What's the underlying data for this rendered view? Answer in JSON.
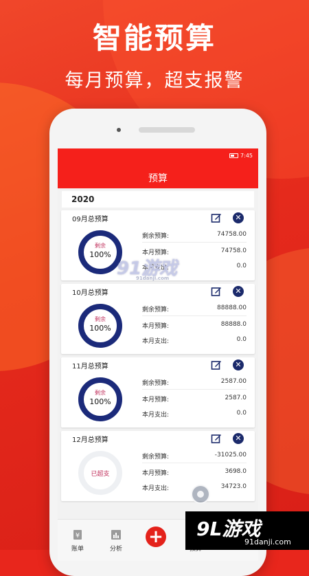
{
  "banner": {
    "title": "智能预算",
    "subtitle": "每月预算，超支报警"
  },
  "status_bar": {
    "time": "7:45"
  },
  "app": {
    "title": "预算",
    "year": "2020"
  },
  "labels": {
    "remaining_budget": "剩余预算:",
    "month_budget": "本月预算:",
    "month_spent": "本月支出:",
    "ring_remaining": "剩余",
    "over_budget": "已超支"
  },
  "cards": [
    {
      "title": "09月总预算",
      "ring_pct": "100%",
      "remaining": "74758.00",
      "budget": "74758.0",
      "spent": "0.0"
    },
    {
      "title": "10月总预算",
      "ring_pct": "100%",
      "remaining": "88888.00",
      "budget": "88888.0",
      "spent": "0.0"
    },
    {
      "title": "11月总预算",
      "ring_pct": "100%",
      "remaining": "2587.00",
      "budget": "2587.0",
      "spent": "0.0"
    },
    {
      "title": "12月总预算",
      "ring_text": "已超支",
      "remaining": "-31025.00",
      "budget": "3698.0",
      "spent": "34723.0"
    }
  ],
  "nav": {
    "bill": "账单",
    "analysis": "分析",
    "budget": "预算"
  },
  "watermark": {
    "center_logo": "91游戏",
    "center_url": "91danji.com",
    "corner_logo": "9L游戏",
    "corner_url": "91danji.com"
  },
  "colors": {
    "brand_red": "#f5201b",
    "ring_navy": "#1b2a7a",
    "over_text": "#c0305c"
  },
  "icons": {
    "edit": "edit-icon",
    "delete": "close-icon",
    "bill": "bill-icon",
    "analysis": "chart-icon",
    "add": "plus-icon",
    "budget": "money-bag-icon"
  }
}
